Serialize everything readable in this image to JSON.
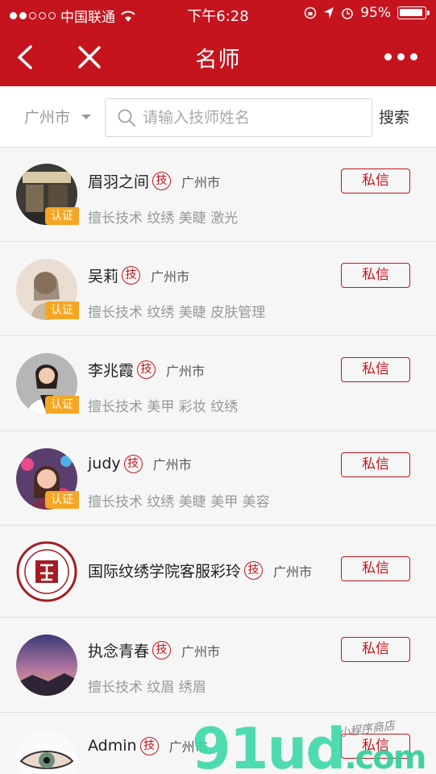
{
  "status_bar": {
    "carrier": "中国联通",
    "time": "下午6:28",
    "battery": "95%",
    "battery_level": 0.95
  },
  "nav": {
    "title": "名师",
    "back_icon": "chevron-left-icon",
    "close_icon": "close-icon",
    "more_icon": "more-dots-icon"
  },
  "search": {
    "city": "广州市",
    "placeholder": "请输入技师姓名",
    "button": "搜索"
  },
  "badge_label": "认证",
  "skill_badge": "技",
  "message_label": "私信",
  "teachers": [
    {
      "name": "眉羽之间",
      "city": "广州市",
      "skills": "擅长技术  纹绣  美睫  激光",
      "verified": true
    },
    {
      "name": "吴莉",
      "city": "广州市",
      "skills": "擅长技术  纹绣  美睫  皮肤管理",
      "verified": true
    },
    {
      "name": "李兆霞",
      "city": "广州市",
      "skills": "擅长技术  美甲  彩妆  纹绣",
      "verified": true
    },
    {
      "name": "judy",
      "city": "广州市",
      "skills": "擅长技术  纹绣  美睫  美甲  美容",
      "verified": true
    },
    {
      "name": "国际纹绣学院客服彩玲",
      "city": "广州市",
      "skills": "",
      "verified": false
    },
    {
      "name": "执念青春",
      "city": "广州市",
      "skills": "擅长技术  纹眉  绣眉",
      "verified": false
    },
    {
      "name": "Admin",
      "city": "广州市",
      "skills": "",
      "verified": false
    }
  ],
  "watermark": {
    "main": "91ud",
    "suffix": ".com",
    "small": "小程序商店"
  },
  "colors": {
    "brand_red": "#c5141e",
    "badge_orange": "#f5a623"
  }
}
